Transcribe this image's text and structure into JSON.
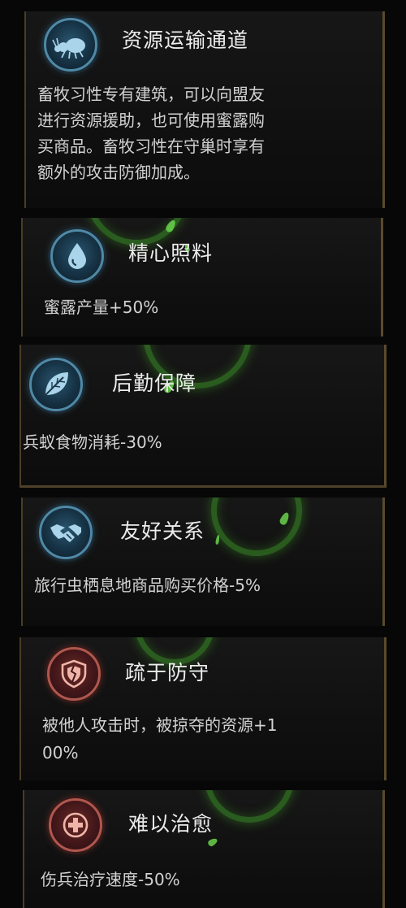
{
  "cards": [
    {
      "title": "资源运输通道",
      "icon": "ant-icon",
      "icon_style": "blue",
      "desc_lines": [
        "畜牧习性专有建筑，可以向盟友",
        "进行资源援助，也可使用蜜露购",
        "买商品。畜牧习性在守巢时享有",
        "额外的攻击防御加成。"
      ]
    },
    {
      "title": "精心照料",
      "icon": "water-drop-icon",
      "icon_style": "blue",
      "desc_lines": [
        "蜜露产量+50%"
      ]
    },
    {
      "title": "后勤保障",
      "icon": "leaf-icon",
      "icon_style": "blue",
      "desc_lines": [
        "兵蚁食物消耗-30%"
      ]
    },
    {
      "title": "友好关系",
      "icon": "handshake-icon",
      "icon_style": "blue",
      "desc_lines": [
        "旅行虫栖息地商品购买价格-5%"
      ]
    },
    {
      "title": "疏于防守",
      "icon": "broken-shield-icon",
      "icon_style": "red",
      "desc_lines": [
        "被他人攻击时，被掠夺的资源+1",
        "00%"
      ]
    },
    {
      "title": "难以治愈",
      "icon": "medical-cross-icon",
      "icon_style": "red",
      "desc_lines": [
        "伤兵治疗速度-50%"
      ]
    }
  ],
  "colors": {
    "title": "#ececec",
    "text": "#d2d2d2",
    "frame": "#5a4a2c",
    "buff_ring": "#4f89a6",
    "debuff_ring": "#b0574e",
    "glow": "#3c9628"
  }
}
